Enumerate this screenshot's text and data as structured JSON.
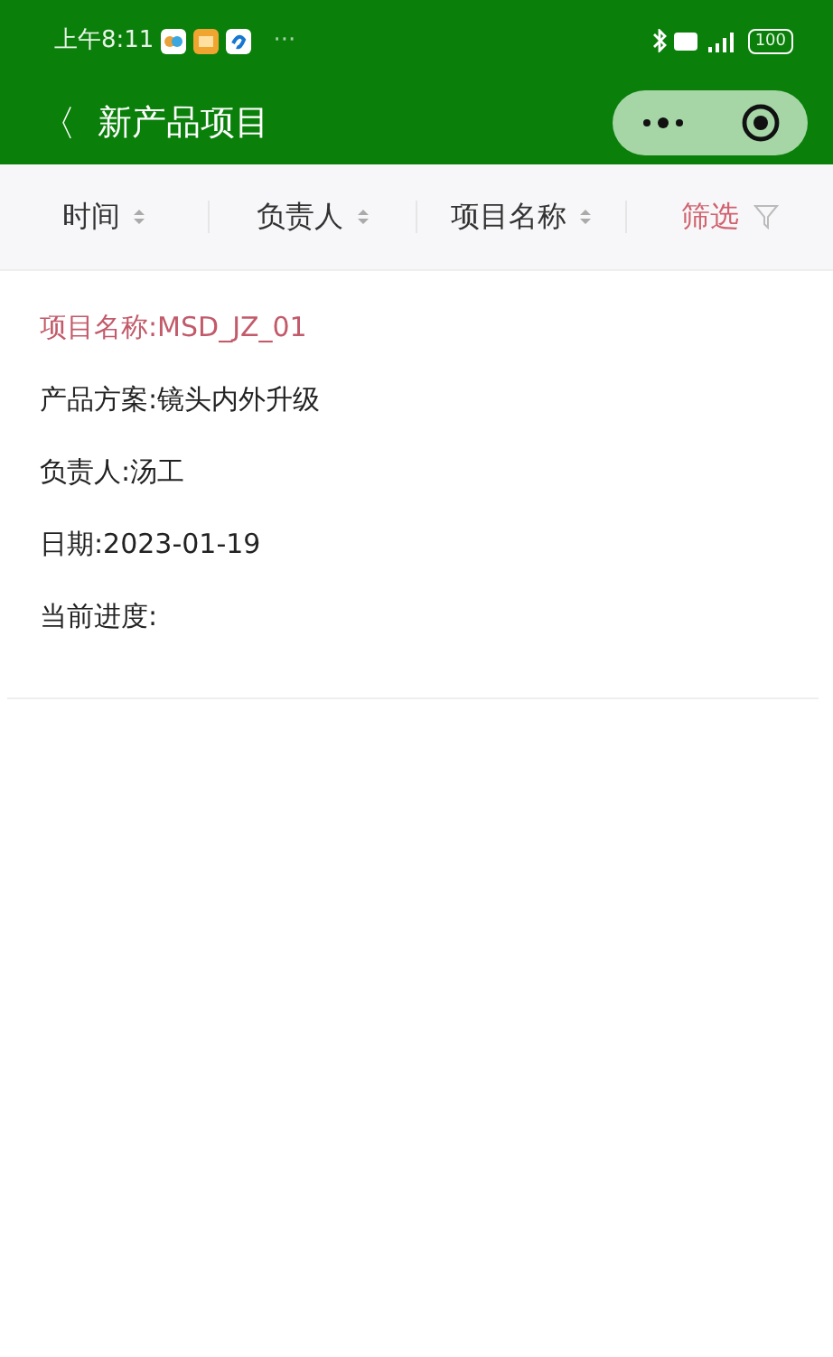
{
  "status_bar": {
    "time": "上午8:11",
    "more": "···",
    "battery": "100"
  },
  "nav": {
    "back": "〈",
    "title": "新产品项目"
  },
  "filter_bar": [
    {
      "kind": "sort",
      "label": "时间"
    },
    {
      "kind": "sort",
      "label": "负责人"
    },
    {
      "kind": "sort",
      "label": "项目名称"
    },
    {
      "kind": "filter",
      "label": "筛选"
    }
  ],
  "projects": [
    {
      "lines": [
        {
          "kind": "title",
          "text": "项目名称:MSD_JZ_01"
        },
        {
          "kind": "field",
          "text": "产品方案:镜头内外升级"
        },
        {
          "kind": "field",
          "text": "负责人:汤工"
        },
        {
          "kind": "field",
          "text": "日期:2023-01-19"
        },
        {
          "kind": "field",
          "text": "当前进度:"
        }
      ]
    }
  ]
}
